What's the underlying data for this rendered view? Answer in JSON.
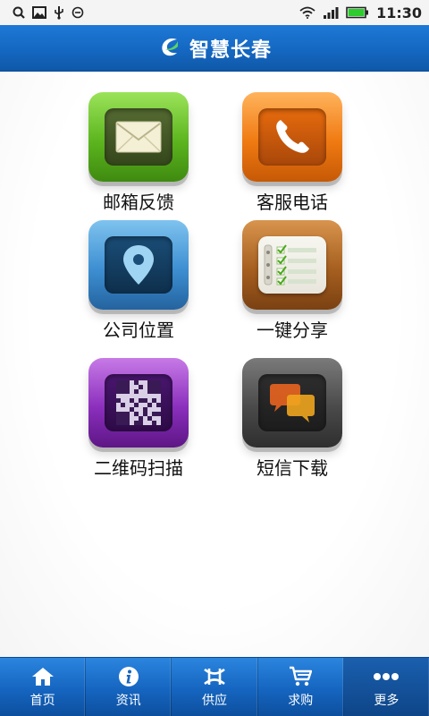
{
  "status_bar": {
    "left_icons": [
      "search-icon",
      "image-icon",
      "usb-icon",
      "clock-icon"
    ],
    "right_icons": [
      "wifi-icon",
      "signal-icon",
      "battery-icon"
    ],
    "time": "11:30",
    "battery_color": "#2ecc2e"
  },
  "header": {
    "title": "智慧长春",
    "logo_icon": "leaf-logo-icon",
    "bar_color": "#1466bf"
  },
  "tiles": [
    {
      "label": "邮箱反馈",
      "icon": "mail-icon",
      "color": "green"
    },
    {
      "label": "客服电话",
      "icon": "phone-icon",
      "color": "orange"
    },
    {
      "label": "公司位置",
      "icon": "location-pin-icon",
      "color": "blue"
    },
    {
      "label": "一键分享",
      "icon": "checklist-icon",
      "color": "brown"
    },
    {
      "label": "二维码扫描",
      "icon": "qr-code-icon",
      "color": "purple"
    },
    {
      "label": "短信下载",
      "icon": "chat-bubbles-icon",
      "color": "gray"
    }
  ],
  "bottom_nav": {
    "items": [
      {
        "label": "首页",
        "icon": "home-icon"
      },
      {
        "label": "资讯",
        "icon": "info-icon"
      },
      {
        "label": "供应",
        "icon": "supply-icon"
      },
      {
        "label": "求购",
        "icon": "cart-icon"
      },
      {
        "label": "更多",
        "icon": "more-icon"
      }
    ],
    "active_index": 4
  }
}
